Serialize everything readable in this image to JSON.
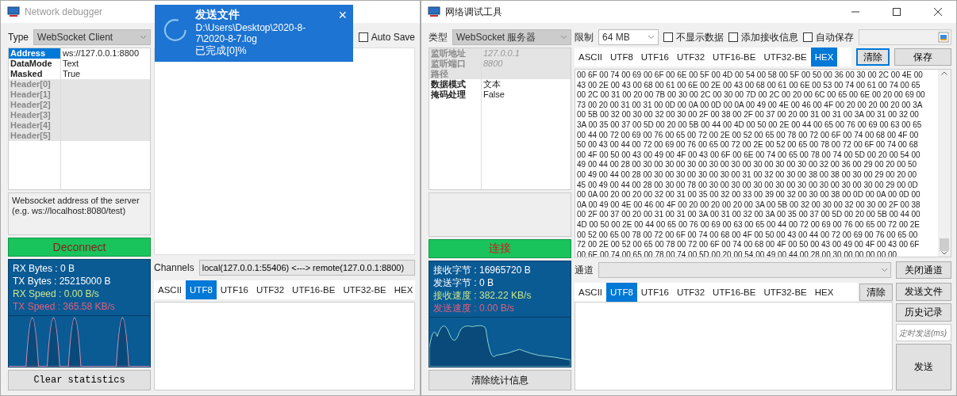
{
  "left_window": {
    "title": "Network debugger",
    "type": {
      "label": "Type",
      "value": "WebSocket Client"
    },
    "auto_save": {
      "label": "Auto Save",
      "checked": false
    },
    "properties": [
      {
        "name": "Address",
        "value": "ws://127.0.0.1:8800",
        "selected": true,
        "disabled": false
      },
      {
        "name": "DataMode",
        "value": "Text",
        "selected": false,
        "disabled": false
      },
      {
        "name": "Masked",
        "value": "True",
        "selected": false,
        "disabled": false
      },
      {
        "name": "Header[0]",
        "selected": false,
        "disabled": true
      },
      {
        "name": "Header[1]",
        "selected": false,
        "disabled": true
      },
      {
        "name": "Header[2]",
        "selected": false,
        "disabled": true
      },
      {
        "name": "Header[3]",
        "selected": false,
        "disabled": true
      },
      {
        "name": "Header[4]",
        "selected": false,
        "disabled": true
      },
      {
        "name": "Header[5]",
        "selected": false,
        "disabled": true
      }
    ],
    "description": "Websocket address of the server\n(e.g. ws://localhost:8080/test)",
    "connect_button": "Deconnect",
    "stats": [
      {
        "text": "RX Bytes : 0 B",
        "color": "#ffffff"
      },
      {
        "text": "TX Bytes : 25215000 B",
        "color": "#ffffff"
      },
      {
        "text": "RX Speed : 0.00 B/s",
        "color": "#c8e68c"
      },
      {
        "text": "TX Speed : 365.58 KB/s",
        "color": "#e0607a"
      }
    ],
    "clear_button": "Clear statistics",
    "channels": {
      "label": "Channels",
      "value": "local(127.0.0.1:55406) <---> remote(127.0.0.1:8800)"
    },
    "send_tabs": [
      {
        "label": "ASCII",
        "selected": false
      },
      {
        "label": "UTF8",
        "selected": true
      },
      {
        "label": "UTF16",
        "selected": false
      },
      {
        "label": "UTF32",
        "selected": false
      },
      {
        "label": "UTF16-BE",
        "selected": false
      },
      {
        "label": "UTF32-BE",
        "selected": false
      },
      {
        "label": "HEX",
        "selected": false
      }
    ]
  },
  "toast": {
    "title": "发送文件",
    "path": "D:\\Users\\Desktop\\2020-8-7\\2020-8-7.log",
    "progress": "已完成[0]%",
    "close": "×"
  },
  "right_window": {
    "title": "网络调试工具",
    "type": {
      "label": "类型",
      "value": "WebSocket 服务器"
    },
    "limit": {
      "label": "限制",
      "value": "64 MB"
    },
    "options": [
      {
        "label": "不显示数据",
        "checked": false
      },
      {
        "label": "添加接收信息",
        "checked": false
      },
      {
        "label": "自动保存",
        "checked": false
      }
    ],
    "properties": [
      {
        "name": "监听地址",
        "value": "127.0.0.1",
        "selected": false,
        "disabled": true
      },
      {
        "name": "监听端口",
        "value": "8800",
        "selected": false,
        "disabled": true
      },
      {
        "name": "路径",
        "selected": false,
        "disabled": true
      },
      {
        "name": "数据模式",
        "value": "文本",
        "selected": false,
        "disabled": false
      },
      {
        "name": "掩码处理",
        "value": "False",
        "selected": false,
        "disabled": false
      }
    ],
    "connect_button": "连接",
    "stats": [
      {
        "text": "接收字节 : 16965720 B",
        "color": "#ffffff"
      },
      {
        "text": "发送字节 : 0 B",
        "color": "#ffffff"
      },
      {
        "text": "接收速度 : 382.22 KB/s",
        "color": "#c8e68c"
      },
      {
        "text": "发送速度 : 0.00 B/s",
        "color": "#e0607a"
      }
    ],
    "clear_button": "清除统计信息",
    "receive_tabs": [
      {
        "label": "ASCII",
        "selected": false
      },
      {
        "label": "UTF8",
        "selected": false
      },
      {
        "label": "UTF16",
        "selected": false
      },
      {
        "label": "UTF32",
        "selected": false
      },
      {
        "label": "UTF16-BE",
        "selected": false
      },
      {
        "label": "UTF32-BE",
        "selected": false
      },
      {
        "label": "HEX",
        "selected": true
      }
    ],
    "receive_buttons": [
      {
        "label": "清除",
        "focused": true
      },
      {
        "label": "保存",
        "focused": false
      }
    ],
    "hex_lines": [
      "00 6F 00 74 00 69 00 6F 00 6E 00 5F 00 4D 00 54 00 58 00 5F 00 50 00 36 00 30 00 2C 00 4E 00",
      "43 00 2E 00 43 00 68 00 61 00 6E 00 2E 00 43 00 68 00 61 00 6E 00 53 00 74 00 61 00 74 00 65",
      "00 2C 00 31 00 20 00 7B 00 30 00 2C 00 30 00 7D 00 2C 00 20 00 6C 00 65 00 6E 00 20 00 69 00",
      "73 00 20 00 31 00 31 00 0D 00 0A 00 0D 00 0A 00 49 00 4E 00 46 00 4F 00 20 00 20 00 20 00 3A",
      "00 5B 00 32 00 30 00 32 00 30 00 2F 00 38 00 2F 00 37 00 20 00 31 00 31 00 3A 00 31 00 32 00",
      "3A 00 35 00 37 00 5D 00 20 00 5B 00 44 00 4D 00 50 00 2E 00 44 00 65 00 76 00 69 00 63 00 65",
      "00 44 00 72 00 69 00 76 00 65 00 72 00 2E 00 52 00 65 00 78 00 72 00 6F 00 74 00 68 00 4F 00",
      "50 00 43 00 44 00 72 00 69 00 76 00 65 00 72 00 2E 00 52 00 65 00 78 00 72 00 6F 00 74 00 68",
      "00 4F 00 50 00 43 00 49 00 4F 00 43 00 6F 00 6E 00 74 00 65 00 78 00 74 00 5D 00 20 00 54 00",
      "49 00 44 00 28 00 30 00 30 00 30 00 30 00 30 00 30 00 30 00 30 00 32 00 36 00 29 00 20 00 50",
      "00 49 00 44 00 28 00 30 00 30 00 30 00 30 00 31 00 32 00 30 00 38 00 38 00 30 00 29 00 20 00",
      "45 00 49 00 44 00 28 00 30 00 78 00 30 00 30 00 30 00 30 00 30 00 30 00 30 00 30 00 29 00 0D",
      "00 0A 00 20 00 20 00 32 00 31 00 35 00 32 00 33 00 39 00 32 00 30 00 38 00 0D 00 0A 00 0D 00",
      "0A 00 49 00 4E 00 46 00 4F 00 20 00 20 00 20 00 3A 00 5B 00 32 00 30 00 32 00 30 00 2F 00 38",
      "00 2F 00 37 00 20 00 31 00 31 00 3A 00 31 00 32 00 3A 00 35 00 37 00 5D 00 20 00 5B 00 44 00",
      "4D 00 50 00 2E 00 44 00 65 00 76 00 69 00 63 00 65 00 44 00 72 00 69 00 76 00 65 00 72 00 2E",
      "00 52 00 65 00 78 00 72 00 6F 00 74 00 68 00 4F 00 50 00 43 00 44 00 72 00 69 00 76 00 65 00",
      "72 00 2E 00 52 00 65 00 78 00 72 00 6F 00 74 00 68 00 4F 00 50 00 43 00 49 00 4F 00 43 00 6F",
      "00 6E 00 74 00 65 00 78 00 74 00 5D 00 20 00 54 00 49 00 44 00 28 00 30 00 00 00 00 00"
    ],
    "channel": {
      "label": "通道",
      "button": "关闭通道"
    },
    "send_tabs": [
      {
        "label": "ASCII",
        "selected": false
      },
      {
        "label": "UTF8",
        "selected": true
      },
      {
        "label": "UTF16",
        "selected": false
      },
      {
        "label": "UTF32",
        "selected": false
      },
      {
        "label": "UTF16-BE",
        "selected": false
      },
      {
        "label": "UTF32-BE",
        "selected": false
      },
      {
        "label": "HEX",
        "selected": false
      }
    ],
    "send_clear": "清除",
    "side_buttons": [
      "发送文件",
      "历史记录"
    ],
    "interval_field": {
      "placeholder": "定时发送(ms)"
    },
    "send_button": "发送"
  }
}
